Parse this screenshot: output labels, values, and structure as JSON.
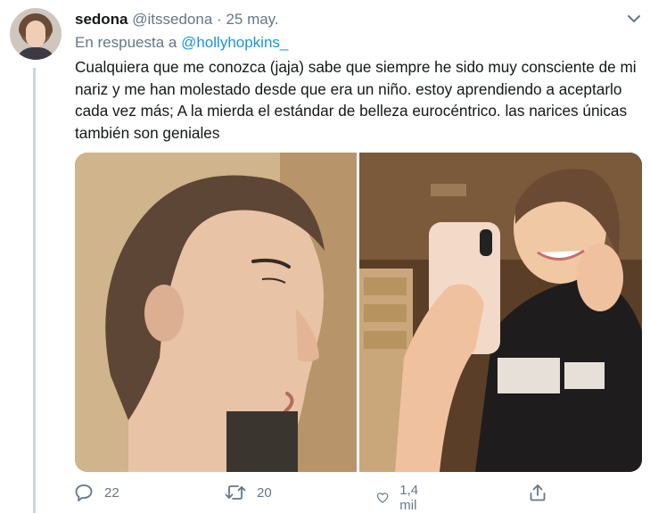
{
  "tweet": {
    "author_name": "sedona",
    "author_handle": "@itssedona",
    "separator": "·",
    "date": "25 may.",
    "reply_prefix": "En respuesta a",
    "reply_handle": "@hollyhopkins_",
    "text": "Cualquiera que me conozca (jaja) sabe que siempre he sido muy consciente de mi nariz y me han molestado desde que era un niño. estoy aprendiendo a aceptarlo cada vez más; A la mierda el estándar de belleza eurocéntrico. las narices únicas también son geniales"
  },
  "actions": {
    "replies": "22",
    "retweets": "20",
    "likes": "1,4 mil"
  },
  "colors": {
    "link": "#1b95e0",
    "muted": "#657786",
    "text": "#14171a",
    "thread_line": "#ccd6dd"
  },
  "icons": {
    "reply": "reply-icon",
    "retweet": "retweet-icon",
    "like": "heart-icon",
    "share": "share-icon",
    "menu": "chevron-down-icon"
  }
}
